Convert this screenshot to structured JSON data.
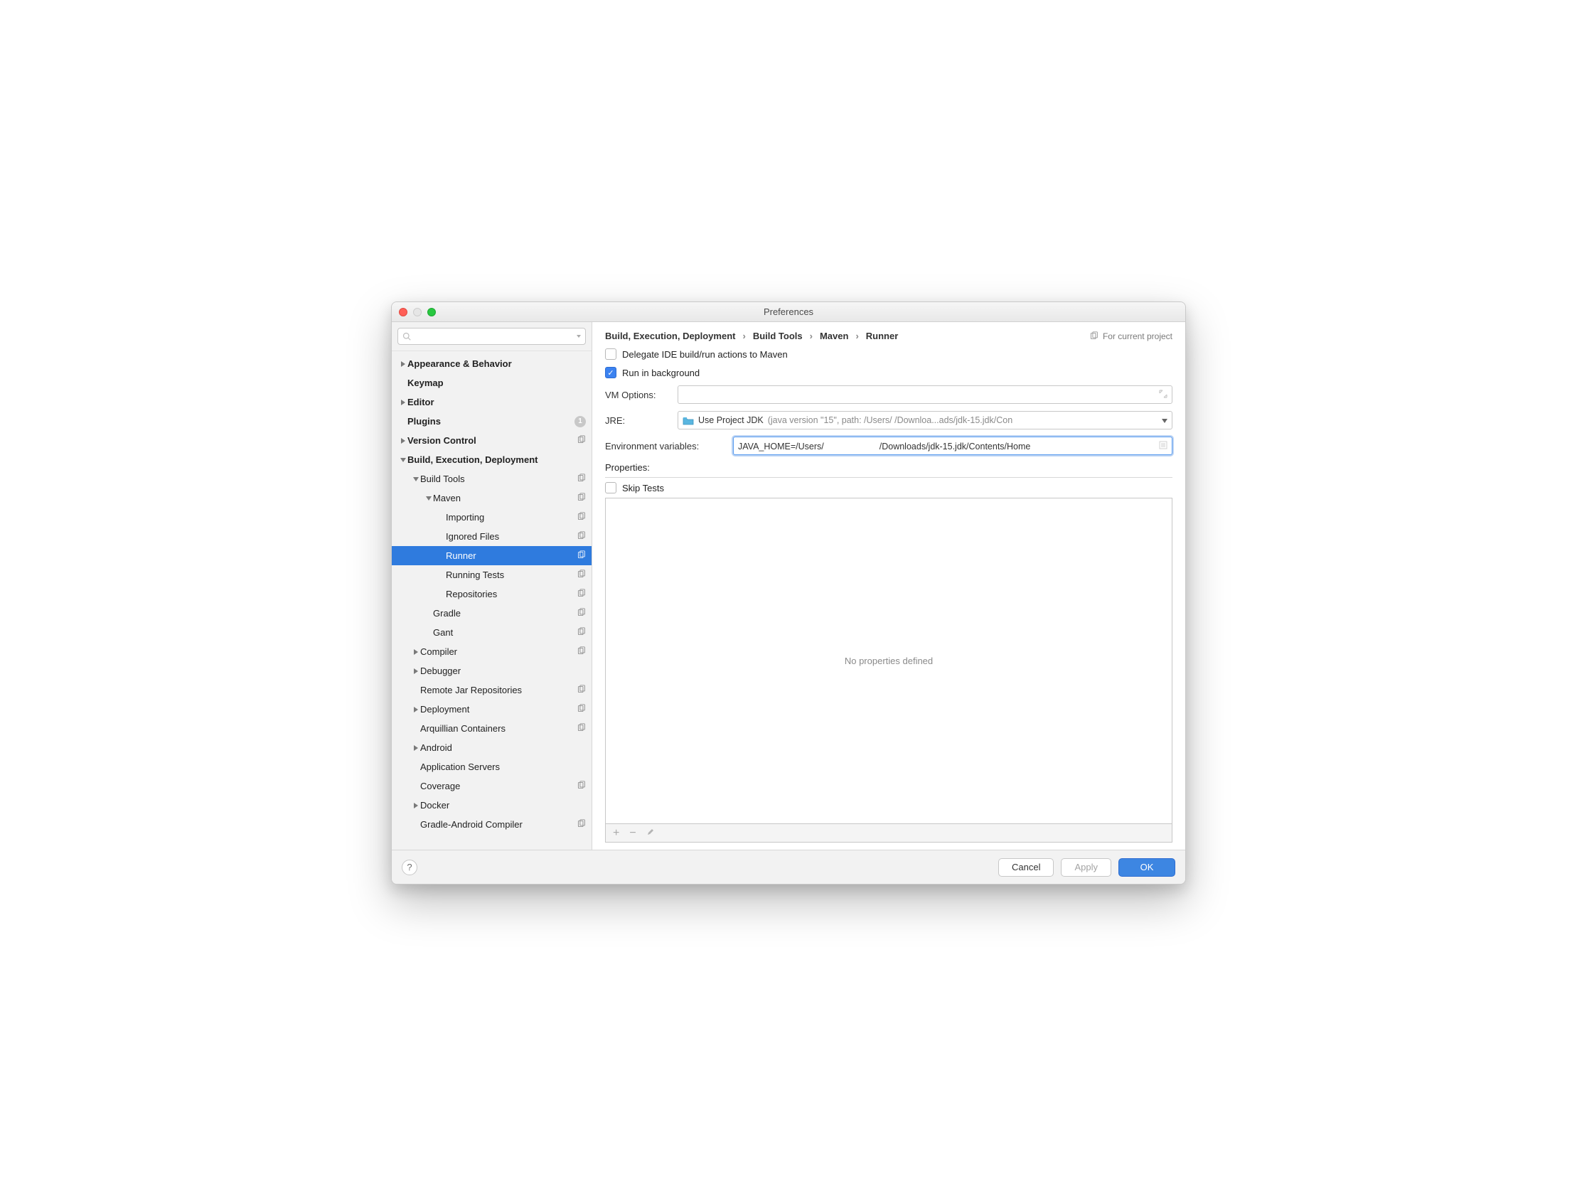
{
  "window": {
    "title": "Preferences"
  },
  "search": {
    "placeholder": ""
  },
  "sidebar": {
    "items": [
      {
        "label": "Appearance & Behavior",
        "indent": 0,
        "bold": true,
        "arrow": "right"
      },
      {
        "label": "Keymap",
        "indent": 0,
        "bold": true,
        "arrow": ""
      },
      {
        "label": "Editor",
        "indent": 0,
        "bold": true,
        "arrow": "right"
      },
      {
        "label": "Plugins",
        "indent": 0,
        "bold": true,
        "arrow": "",
        "badge": "1"
      },
      {
        "label": "Version Control",
        "indent": 0,
        "bold": true,
        "arrow": "right",
        "proj": true
      },
      {
        "label": "Build, Execution, Deployment",
        "indent": 0,
        "bold": true,
        "arrow": "down"
      },
      {
        "label": "Build Tools",
        "indent": 1,
        "bold": false,
        "arrow": "down",
        "proj": true
      },
      {
        "label": "Maven",
        "indent": 2,
        "bold": false,
        "arrow": "down",
        "proj": true
      },
      {
        "label": "Importing",
        "indent": 3,
        "bold": false,
        "arrow": "",
        "proj": true
      },
      {
        "label": "Ignored Files",
        "indent": 3,
        "bold": false,
        "arrow": "",
        "proj": true
      },
      {
        "label": "Runner",
        "indent": 3,
        "bold": false,
        "arrow": "",
        "proj": true,
        "selected": true
      },
      {
        "label": "Running Tests",
        "indent": 3,
        "bold": false,
        "arrow": "",
        "proj": true
      },
      {
        "label": "Repositories",
        "indent": 3,
        "bold": false,
        "arrow": "",
        "proj": true
      },
      {
        "label": "Gradle",
        "indent": 2,
        "bold": false,
        "arrow": "",
        "proj": true
      },
      {
        "label": "Gant",
        "indent": 2,
        "bold": false,
        "arrow": "",
        "proj": true
      },
      {
        "label": "Compiler",
        "indent": 1,
        "bold": false,
        "arrow": "right",
        "proj": true
      },
      {
        "label": "Debugger",
        "indent": 1,
        "bold": false,
        "arrow": "right"
      },
      {
        "label": "Remote Jar Repositories",
        "indent": 1,
        "bold": false,
        "arrow": "",
        "proj": true
      },
      {
        "label": "Deployment",
        "indent": 1,
        "bold": false,
        "arrow": "right",
        "proj": true
      },
      {
        "label": "Arquillian Containers",
        "indent": 1,
        "bold": false,
        "arrow": "",
        "proj": true
      },
      {
        "label": "Android",
        "indent": 1,
        "bold": false,
        "arrow": "right"
      },
      {
        "label": "Application Servers",
        "indent": 1,
        "bold": false,
        "arrow": ""
      },
      {
        "label": "Coverage",
        "indent": 1,
        "bold": false,
        "arrow": "",
        "proj": true
      },
      {
        "label": "Docker",
        "indent": 1,
        "bold": false,
        "arrow": "right"
      },
      {
        "label": "Gradle-Android Compiler",
        "indent": 1,
        "bold": false,
        "arrow": "",
        "proj": true
      }
    ]
  },
  "breadcrumb": {
    "items": [
      "Build, Execution, Deployment",
      "Build Tools",
      "Maven",
      "Runner"
    ],
    "note": "For current project"
  },
  "form": {
    "delegate_label": "Delegate IDE build/run actions to Maven",
    "delegate_checked": false,
    "background_label": "Run in background",
    "background_checked": true,
    "vm_label": "VM Options:",
    "vm_value": "",
    "jre_label": "JRE:",
    "jre_value": "Use Project JDK",
    "jre_hint": "(java version \"15\", path: /Users/                 /Downloa...ads/jdk-15.jdk/Con",
    "env_label": "Environment variables:",
    "env_value_pre": "JAVA_HOME=/Users/",
    "env_value_post": "/Downloads/jdk-15.jdk/Contents/Home",
    "props_label": "Properties:",
    "skip_label": "Skip Tests",
    "skip_checked": false,
    "props_empty": "No properties defined"
  },
  "footer": {
    "cancel": "Cancel",
    "apply": "Apply",
    "ok": "OK"
  }
}
